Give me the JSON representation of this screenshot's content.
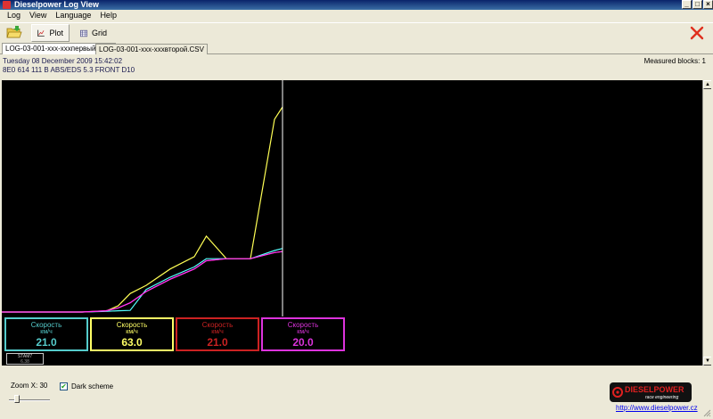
{
  "window": {
    "title": "Dieselpower Log View",
    "controls": {
      "minimize": "_",
      "maximize": "□",
      "close": "×"
    }
  },
  "menu": [
    "Log",
    "View",
    "Language",
    "Help"
  ],
  "toolbar": {
    "plot_label": "Plot",
    "grid_label": "Grid"
  },
  "tabs": [
    {
      "label": "LOG-03-001-xxx-xxxпервый.CSV",
      "active": true
    },
    {
      "label": "LOG-03-001-xxx-xxxвторой.CSV",
      "active": false
    }
  ],
  "info": {
    "date": "Tuesday 08 December 2009 15:42:02",
    "ecu": "8E0 614 111 B  ABS/EDS 5.3 FRONT   D10",
    "measured_blocks": "Measured blocks: 1"
  },
  "chart_data": {
    "type": "line",
    "grid": false,
    "x": [
      0,
      5,
      10,
      13,
      14.5,
      16,
      18,
      21,
      24,
      25.5,
      28,
      29,
      31,
      34,
      35
    ],
    "series": [
      {
        "color": "#ffff55",
        "values": [
          0,
          0,
          0,
          0.5,
          3,
          9,
          13,
          21,
          27,
          37,
          26,
          26,
          26,
          94,
          100
        ]
      },
      {
        "color": "#55ffff",
        "values": [
          0,
          0,
          0,
          0.3,
          0.6,
          0.8,
          11,
          17,
          22,
          26,
          26,
          26,
          26,
          30,
          31
        ]
      },
      {
        "color": "#ff3333",
        "values": [
          0,
          0,
          0,
          0.6,
          2,
          4.5,
          10,
          16,
          21,
          25,
          26,
          26,
          26,
          29,
          29.5
        ]
      },
      {
        "color": "#ff33ff",
        "values": [
          0,
          0,
          0,
          0.6,
          2,
          4.5,
          10,
          16,
          21,
          25,
          26,
          26,
          26,
          29,
          29.5
        ]
      }
    ],
    "cursor_x": 35,
    "ylim": [
      0,
      100
    ]
  },
  "gauges": [
    {
      "title": "Скорость",
      "unit": "км/ч",
      "value": "21.0",
      "color": "#55cccc"
    },
    {
      "title": "Скорость",
      "unit": "км/ч",
      "value": "63.0",
      "color": "#ffff66"
    },
    {
      "title": "Скорость",
      "unit": "км/ч",
      "value": "21.0",
      "color": "#cc2222"
    },
    {
      "title": "Скорость",
      "unit": "км/ч",
      "value": "20.0",
      "color": "#dd33dd"
    }
  ],
  "stat_box": {
    "title": "STAM7",
    "value": "6.38"
  },
  "zoom": {
    "label": "Zoom X: 30",
    "value": 30
  },
  "dark_scheme": {
    "label": "Dark scheme",
    "checked": true
  },
  "logo": {
    "line1": "DIESELPOWER",
    "line2": "race engineering"
  },
  "link": "http://www.dieselpower.cz"
}
